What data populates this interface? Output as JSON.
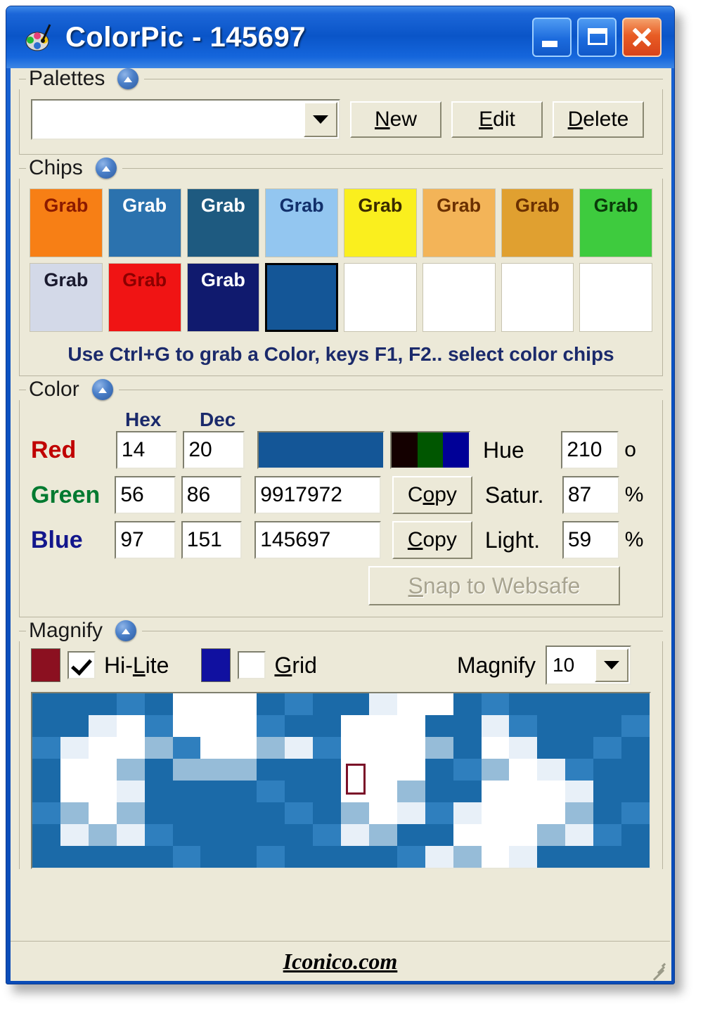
{
  "window": {
    "title": "ColorPic - 145697",
    "app_icon": "colorpic-palette-icon",
    "buttons": {
      "minimize": "minimize-icon",
      "maximize": "maximize-icon",
      "close": "close-icon"
    },
    "frame_color": "#0a50c0"
  },
  "palettes": {
    "group_title": "Palettes",
    "collapse_icon": "chevron-up-icon",
    "selected": "",
    "placeholder": "",
    "buttons": [
      {
        "label": "New",
        "accel": "N"
      },
      {
        "label": "Edit",
        "accel": "E"
      },
      {
        "label": "Delete",
        "accel": "D"
      }
    ]
  },
  "chips": {
    "group_title": "Chips",
    "collapse_icon": "chevron-up-icon",
    "grab_label": "Grab",
    "hint": "Use Ctrl+G to grab a Color, keys F1, F2.. select color chips",
    "row1": [
      {
        "color": "#F77F15",
        "text_color": "#8B1A00",
        "label": "Grab",
        "empty": false,
        "selected": false
      },
      {
        "color": "#2B72AE",
        "text_color": "#FFFFFF",
        "label": "Grab",
        "empty": false,
        "selected": false
      },
      {
        "color": "#1E5A80",
        "text_color": "#FFFFFF",
        "label": "Grab",
        "empty": false,
        "selected": false
      },
      {
        "color": "#93C6F0",
        "text_color": "#12306B",
        "label": "Grab",
        "empty": false,
        "selected": false
      },
      {
        "color": "#FAEF1E",
        "text_color": "#3A2A00",
        "label": "Grab",
        "empty": false,
        "selected": false
      },
      {
        "color": "#F3B458",
        "text_color": "#6B3000",
        "label": "Grab",
        "empty": false,
        "selected": false
      },
      {
        "color": "#E0A030",
        "text_color": "#6B3000",
        "label": "Grab",
        "empty": false,
        "selected": false
      },
      {
        "color": "#3ECB3E",
        "text_color": "#0A3A0A",
        "label": "Grab",
        "empty": false,
        "selected": false
      }
    ],
    "row2": [
      {
        "color": "#D3D9E8",
        "text_color": "#1A1A2E",
        "label": "Grab",
        "empty": false,
        "selected": false
      },
      {
        "color": "#F01414",
        "text_color": "#8B0000",
        "label": "Grab",
        "empty": false,
        "selected": false
      },
      {
        "color": "#101A6E",
        "text_color": "#FFFFFF",
        "label": "Grab",
        "empty": false,
        "selected": false
      },
      {
        "color": "#145697",
        "text_color": "#FFFFFF",
        "label": "",
        "empty": false,
        "selected": true
      },
      {
        "color": "#FFFFFF",
        "text_color": "#000000",
        "label": "",
        "empty": true,
        "selected": false
      },
      {
        "color": "#FFFFFF",
        "text_color": "#000000",
        "label": "",
        "empty": true,
        "selected": false
      },
      {
        "color": "#FFFFFF",
        "text_color": "#000000",
        "label": "",
        "empty": true,
        "selected": false
      },
      {
        "color": "#FFFFFF",
        "text_color": "#000000",
        "label": "",
        "empty": true,
        "selected": false
      }
    ]
  },
  "color": {
    "group_title": "Color",
    "collapse_icon": "chevron-up-icon",
    "header_hex": "Hex",
    "header_dec": "Dec",
    "channels": [
      {
        "name": "Red",
        "hex": "14",
        "dec": "20"
      },
      {
        "name": "Green",
        "hex": "56",
        "dec": "86"
      },
      {
        "name": "Blue",
        "hex": "97",
        "dec": "151"
      }
    ],
    "preview_color": "#145697",
    "strip": {
      "red": "#140000",
      "green": "#005600",
      "blue": "#000097"
    },
    "dec_value": "9917972",
    "hex_value": "145697",
    "copy_dec_label": "Copy",
    "copy_dec_accel": "o",
    "copy_hex_label": "Copy",
    "copy_hex_accel": "C",
    "hue_label": "Hue",
    "hue_value": "210",
    "hue_unit": "o",
    "satur_label": "Satur.",
    "satur_value": "87",
    "satur_unit": "%",
    "light_label": "Light.",
    "light_value": "59",
    "light_unit": "%",
    "snap_label": "Snap to Websafe",
    "snap_accel": "S",
    "snap_disabled": true
  },
  "magnify": {
    "group_title": "Magnify",
    "collapse_icon": "chevron-up-icon",
    "hilite_label": "Hi-Lite",
    "hilite_accel": "L",
    "hilite_checked": true,
    "hilite_color": "#8B1020",
    "grid_label": "Grid",
    "grid_accel": "G",
    "grid_checked": false,
    "grid_color": "#1010A0",
    "magnify_label": "Magnify",
    "magnify_value": "10",
    "cursor_color": "#7a1028"
  },
  "statusbar": {
    "link": "Iconico.com",
    "resize_grip": "resize-grip-icon"
  }
}
